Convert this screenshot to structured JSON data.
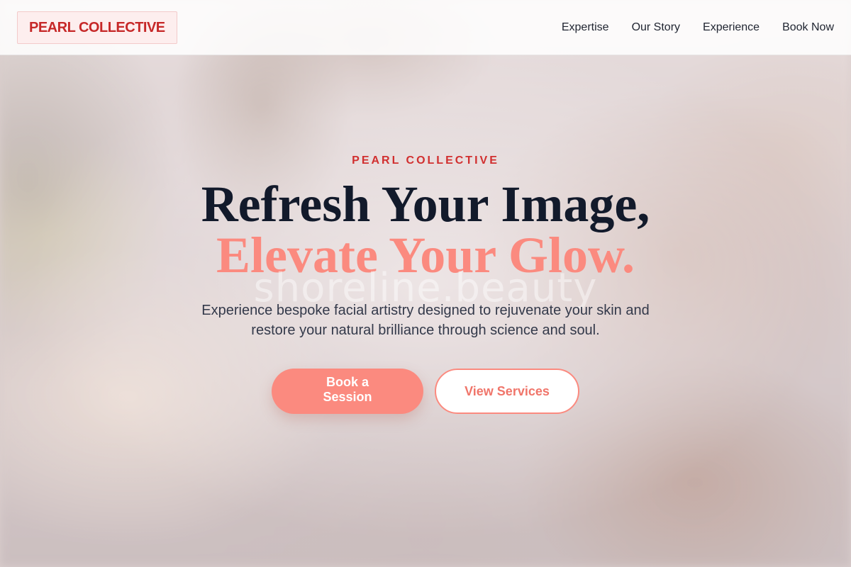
{
  "brand": {
    "logo_text": "PEARL COLLECTIVE"
  },
  "nav": {
    "items": [
      {
        "label": "Expertise"
      },
      {
        "label": "Our Story"
      },
      {
        "label": "Experience"
      },
      {
        "label": "Book Now"
      }
    ]
  },
  "hero": {
    "eyebrow": "PEARL COLLECTIVE",
    "headline_line1": "Refresh Your Image,",
    "headline_line2": "Elevate Your Glow.",
    "watermark": "shoreline.beauty",
    "subtext": "Experience bespoke facial artistry designed to rejuvenate your skin and restore your natural brilliance through science and soul.",
    "primary_button": "Book a Session",
    "secondary_button": "View Services"
  },
  "colors": {
    "accent_coral": "#fb8a7f",
    "brand_red": "#c62828",
    "headline_navy": "#121a2b"
  }
}
